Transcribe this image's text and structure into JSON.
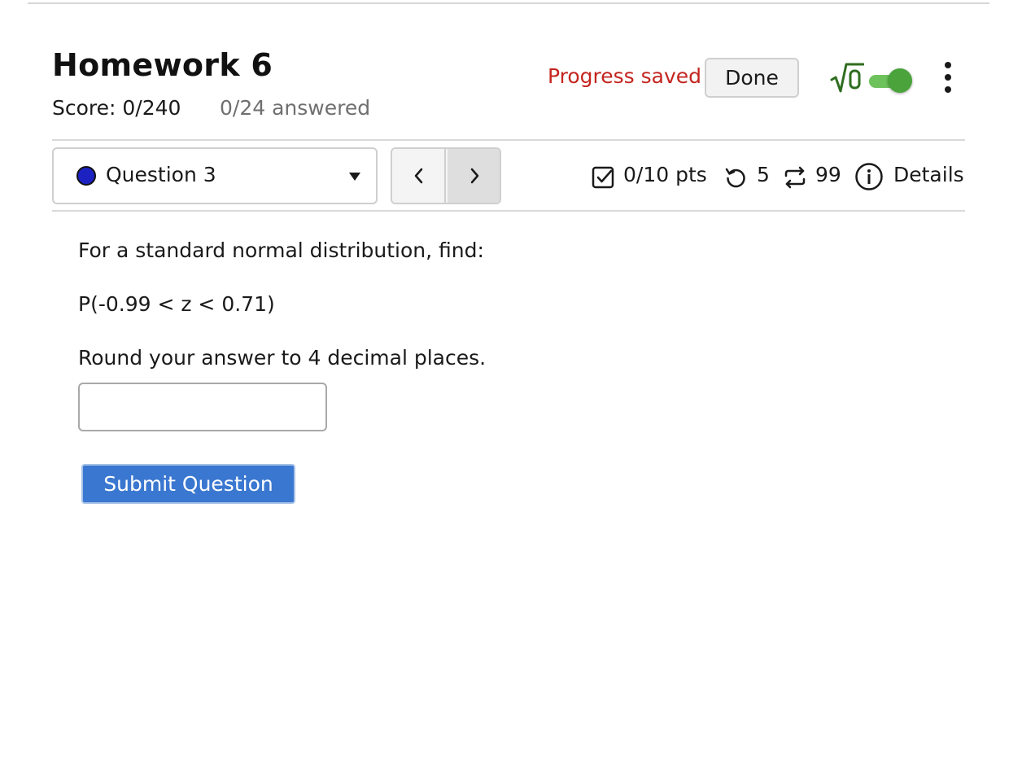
{
  "header": {
    "title": "Homework 6",
    "score": "Score: 0/240",
    "answered": "0/24 answered",
    "progress_status": "Progress saved",
    "done_label": "Done",
    "math_toggle_icon": "sqrt-zero-icon",
    "math_toggle_on": true,
    "menu_icon": "kebab-menu-icon"
  },
  "question_nav": {
    "selected_question": "Question 3",
    "status_dot_color": "#1c22c2",
    "prev_icon": "chevron-left-icon",
    "next_icon": "chevron-right-icon"
  },
  "question_meta": {
    "points": "0/10 pts",
    "attempts": "5",
    "versions": "99",
    "details_label": "Details"
  },
  "question": {
    "line1": "For a standard normal distribution, find:",
    "line2": "P(-0.99 < z < 0.71)",
    "line3": "Round your answer to 4 decimal places.",
    "answer_value": "",
    "submit_label": "Submit Question"
  },
  "colors": {
    "progress_red": "#c4251f",
    "accent_green": "#2f6d1f",
    "toggle_green": "#4aa33b",
    "submit_blue": "#3a77d0"
  }
}
